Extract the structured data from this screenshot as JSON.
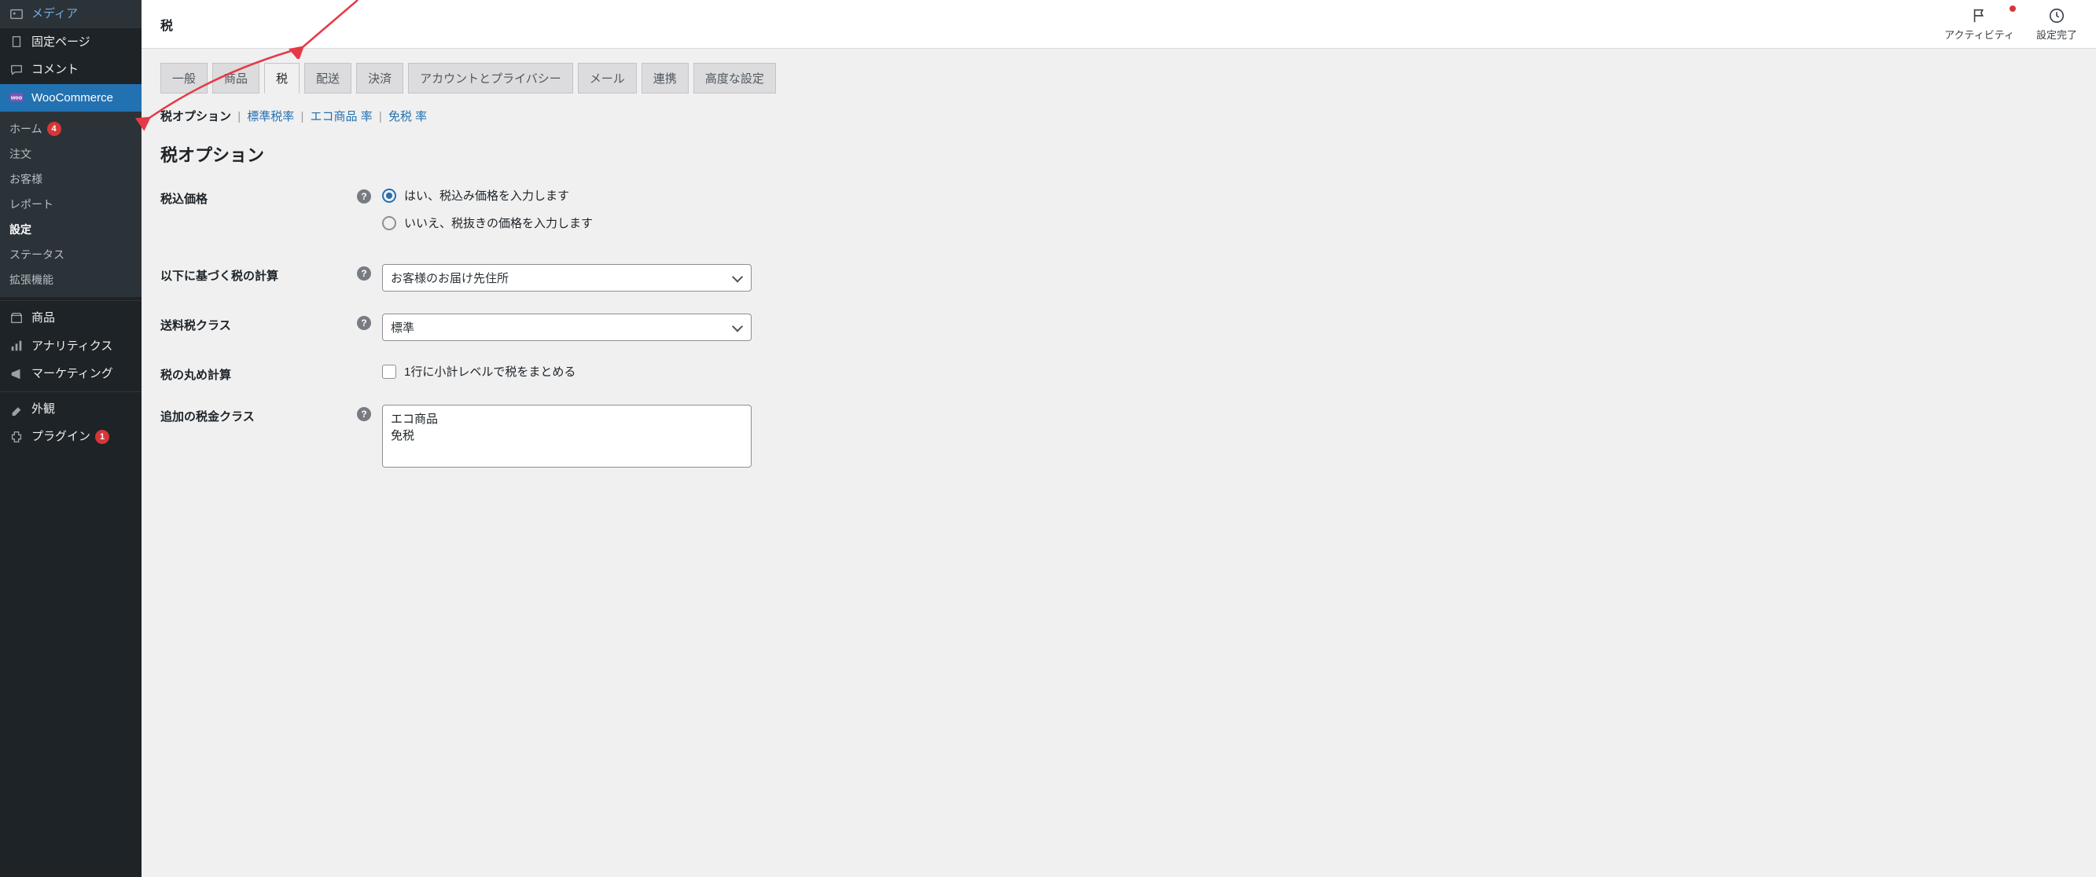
{
  "sidebar": {
    "media": "メディア",
    "pages": "固定ページ",
    "comments": "コメント",
    "woocommerce": "WooCommerce",
    "products": "商品",
    "analytics": "アナリティクス",
    "marketing": "マーケティング",
    "appearance": "外観",
    "plugins": "プラグイン",
    "pluginsBadge": "1",
    "sub": {
      "home": "ホーム",
      "homeBadge": "4",
      "orders": "注文",
      "customers": "お客様",
      "reports": "レポート",
      "settings": "設定",
      "status": "ステータス",
      "extensions": "拡張機能"
    }
  },
  "topbar": {
    "title": "税",
    "activity": "アクティビティ",
    "setupDone": "設定完了"
  },
  "tabs": {
    "general": "一般",
    "products": "商品",
    "tax": "税",
    "shipping": "配送",
    "payments": "決済",
    "accounts": "アカウントとプライバシー",
    "emails": "メール",
    "integration": "連携",
    "advanced": "高度な設定"
  },
  "subnav": {
    "options": "税オプション",
    "standard": "標準税率",
    "eco": "エコ商品 率",
    "exempt": "免税 率"
  },
  "heading": "税オプション",
  "fields": {
    "pricesEnteredLabel": "税込価格",
    "pricesYes": "はい、税込み価格を入力します",
    "pricesNo": "いいえ、税抜きの価格を入力します",
    "calcBasedOnLabel": "以下に基づく税の計算",
    "calcBasedOnValue": "お客様のお届け先住所",
    "shippingTaxClassLabel": "送料税クラス",
    "shippingTaxClassValue": "標準",
    "roundingLabel": "税の丸め計算",
    "roundingCheck": "1行に小計レベルで税をまとめる",
    "additionalClassesLabel": "追加の税金クラス",
    "additionalClassesValue": "エコ商品\n免税"
  }
}
